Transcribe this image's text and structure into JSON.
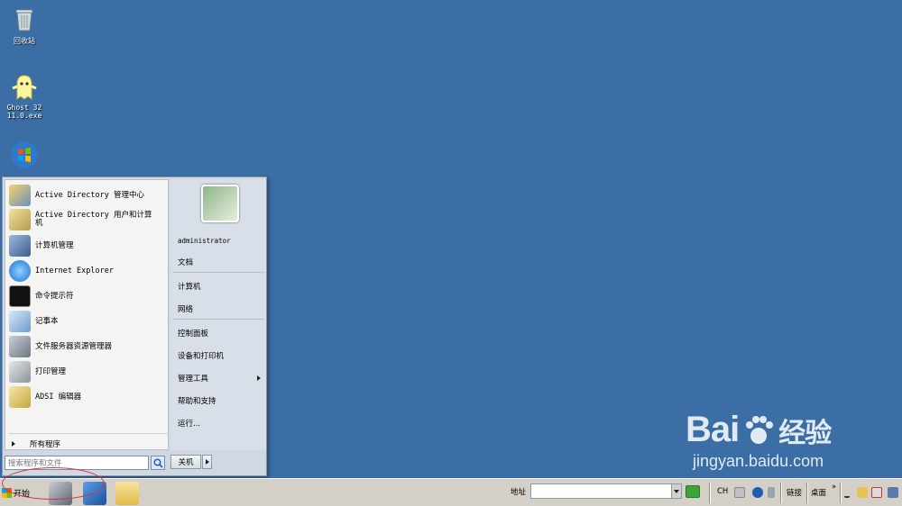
{
  "desktop": {
    "icons": [
      {
        "label": "回收站",
        "icon": "recycle-bin-icon"
      },
      {
        "label": "Ghost 32\n11.0.exe",
        "icon": "ghost-icon"
      },
      {
        "label": "",
        "icon": "windows-logo-icon"
      }
    ]
  },
  "start_menu": {
    "programs": [
      {
        "label": "Active Directory 管理中心",
        "icon": "ad-admin-center-icon"
      },
      {
        "label": "Active Directory 用户和计算机",
        "icon": "ad-users-computers-icon"
      },
      {
        "label": "计算机管理",
        "icon": "computer-management-icon"
      },
      {
        "label": "Internet Explorer",
        "icon": "internet-explorer-icon"
      },
      {
        "label": "命令提示符",
        "icon": "command-prompt-icon"
      },
      {
        "label": "记事本",
        "icon": "notepad-icon"
      },
      {
        "label": "文件服务器资源管理器",
        "icon": "file-server-icon"
      },
      {
        "label": "打印管理",
        "icon": "print-management-icon"
      },
      {
        "label": "ADSI 编辑器",
        "icon": "adsi-editor-icon"
      }
    ],
    "all_programs": "所有程序",
    "search_placeholder": "搜索程序和文件",
    "user": "administrator",
    "right_items": {
      "documents": "文档",
      "computer": "计算机",
      "network": "网络",
      "control_panel": "控制面板",
      "devices_printers": "设备和打印机",
      "admin_tools": "管理工具",
      "help": "帮助和支持",
      "run": "运行..."
    },
    "shutdown": "关机"
  },
  "taskbar": {
    "start_label": "开始",
    "address_label": "地址",
    "address_value": "",
    "lang": "CH",
    "links": "链接",
    "desktop": "桌面",
    "more": "»"
  },
  "watermark": {
    "brand": "Bai",
    "brand_suffix": "经验",
    "url": "jingyan.baidu.com"
  }
}
